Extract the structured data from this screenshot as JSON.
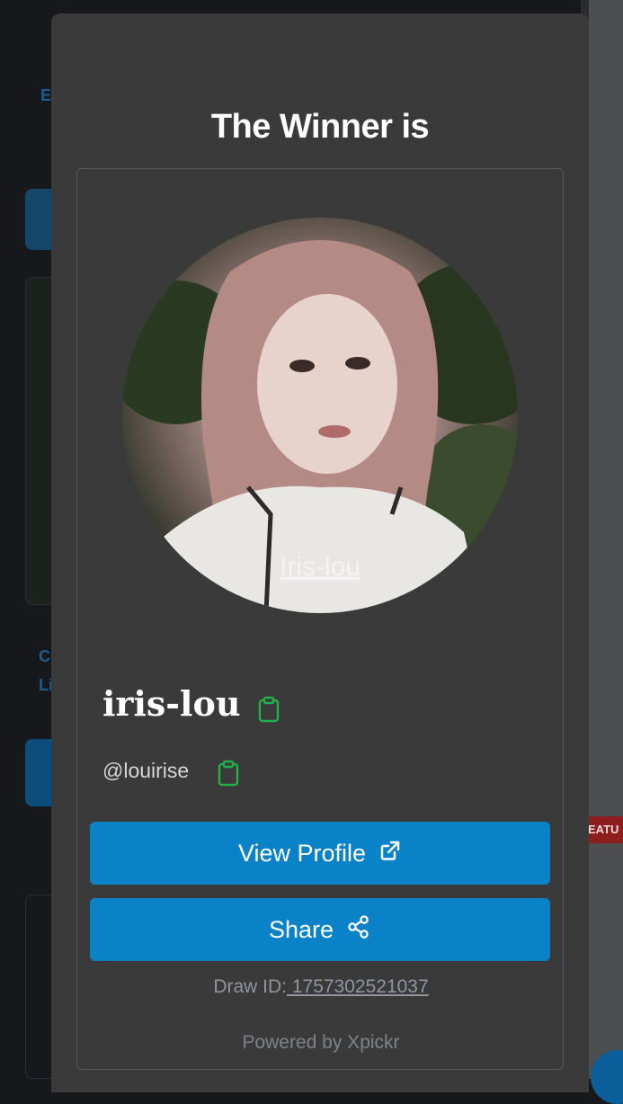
{
  "background": {
    "letters": [
      "E",
      "C",
      "Li"
    ],
    "feature_badge": "EATU"
  },
  "modal": {
    "title": "The Winner is",
    "winner": {
      "avatar_caption": "Iris-lou",
      "name": "iris-lou",
      "handle": "@louirise"
    },
    "buttons": {
      "view_profile": "View Profile",
      "share": "Share"
    },
    "draw_id_label": "Draw ID:",
    "draw_id_value": " 1757302521037",
    "powered_by": "Powered by Xpickr"
  },
  "icons": {
    "copy": "clipboard-icon",
    "external": "external-link-icon",
    "share": "share-nodes-icon"
  },
  "colors": {
    "modal_bg": "#3a3a3a",
    "button": "#0a82c7",
    "copy_icon": "#22b04b"
  }
}
